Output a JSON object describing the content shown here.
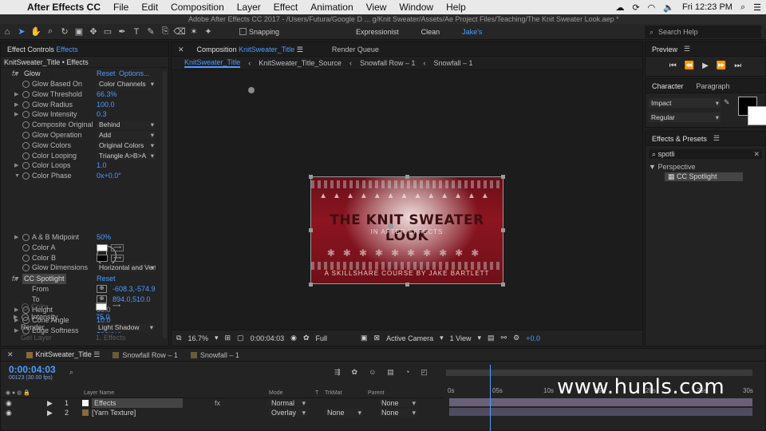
{
  "menubar": {
    "app": "After Effects CC",
    "items": [
      "File",
      "Edit",
      "Composition",
      "Layer",
      "Effect",
      "Animation",
      "View",
      "Window",
      "Help"
    ],
    "clock": "Fri 12:23 PM"
  },
  "titlebar": {
    "text": "Adobe After Effects CC 2017 - /Users/Futura/Google D ... g/Knit Sweater/Assets/Ae Project Files/Teaching/The Knit Sweater Look.aep *"
  },
  "toolbar": {
    "snapping_label": "Snapping",
    "workspaces": [
      "Expressionist",
      "Clean",
      "Jake's"
    ],
    "active_workspace": "Jake's",
    "search_help_placeholder": "Search Help"
  },
  "effect_controls": {
    "tab_prefix": "Effect Controls",
    "tab_suffix": "Effects",
    "header": "KnitSweater_Title • Effects",
    "glow_rows": [
      {
        "label": "Glow Based On",
        "dropdown": "Color Channels"
      },
      {
        "label": "Glow Threshold",
        "value": "66.3%"
      },
      {
        "label": "Glow Radius",
        "value": "100.0"
      },
      {
        "label": "Glow Intensity",
        "value": "0.3"
      },
      {
        "label": "Composite Original",
        "dropdown": "Behind"
      },
      {
        "label": "Glow Operation",
        "dropdown": "Add"
      },
      {
        "label": "Glow Colors",
        "dropdown": "Original Colors"
      },
      {
        "label": "Color Looping",
        "dropdown": "Triangle A>B>A"
      },
      {
        "label": "Color Loops",
        "value": "1.0"
      },
      {
        "label": "Color Phase",
        "value": "0x+0.0°"
      }
    ],
    "glow_rows2": [
      {
        "label": "A & B Midpoint",
        "value": "50%"
      },
      {
        "label": "Color A"
      },
      {
        "label": "Color B"
      },
      {
        "label": "Glow Dimensions",
        "dropdown": "Horizontal and Vertical"
      }
    ],
    "spotlight": {
      "name": "CC Spotlight",
      "reset": "Reset",
      "from_label": "From",
      "from_value": "-608.3,-574.9",
      "to_label": "To",
      "to_value": "894.0,510.0",
      "height_label": "Height",
      "height_value": "50.0",
      "cone_label": "Cone Angle",
      "cone_value": "10.0",
      "edge_label": "Edge Softness",
      "edge_value": "100.0%",
      "color_label": "Color",
      "intensity_label": "Intensity",
      "intensity_value": "75.0",
      "render_label": "Render",
      "render_value": "Light Shadow",
      "gel_label": "Gel Layer",
      "gel_value": "1. Effects"
    },
    "glow_name": "Glow",
    "glow_reset": "Reset",
    "glow_options": "Options..."
  },
  "composition": {
    "tab_prefix": "Composition",
    "tab_name": "KnitSweater_Title",
    "render_queue": "Render Queue",
    "crumbs": [
      "KnitSweater_Title",
      "KnitSweater_Title_Source",
      "Snowfall Row – 1",
      "Snowfall – 1"
    ],
    "frame": {
      "title": "THE KNIT SWEATER LOOK",
      "subtitle": "IN AFTER EFFECTS",
      "credit": "A SKILLSHARE COURSE BY JAKE BARTLETT"
    },
    "viewer_bar": {
      "zoom": "16.7%",
      "time": "0:00:04:03",
      "resolution": "Full",
      "camera": "Active Camera",
      "views": "1 View",
      "exposure": "+0.0"
    }
  },
  "preview": {
    "title": "Preview"
  },
  "character": {
    "tabs": [
      "Character",
      "Paragraph"
    ],
    "font": "Impact",
    "style": "Regular"
  },
  "effects_presets": {
    "title": "Effects & Presets",
    "search": "spotli",
    "category": "Perspective",
    "item": "CC Spotlight"
  },
  "timeline": {
    "tabs": [
      "KnitSweater_Title",
      "Snowfall Row – 1",
      "Snowfall – 1"
    ],
    "current_time": "0:00:04:03",
    "fps": "00123 (30.00 fps)",
    "columns": {
      "name": "Layer Name",
      "mode": "Mode",
      "t": "T",
      "trkmat": "TrkMat",
      "parent": "Parent"
    },
    "layers": [
      {
        "num": "1",
        "name": "Effects",
        "mode": "Normal",
        "trkmat": "",
        "parent": "None"
      },
      {
        "num": "2",
        "name": "[Yarn Texture]",
        "mode": "Overlay",
        "trkmat": "None",
        "parent": "None"
      }
    ],
    "ruler_labels": [
      "0s",
      "05s",
      "10s",
      "15s",
      "20s",
      "25s",
      "30s"
    ]
  },
  "watermark": "www.hunls.com",
  "colors": {
    "accent": "#4d9cff",
    "panel": "#232323",
    "background": "#1e1e1e"
  }
}
